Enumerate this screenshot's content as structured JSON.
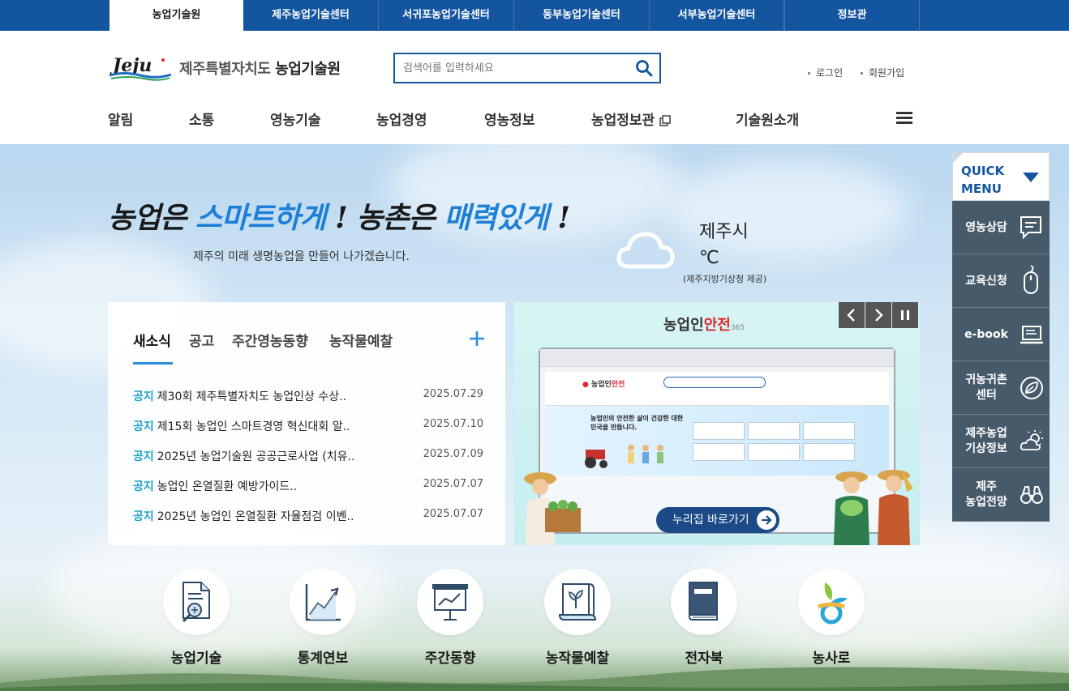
{
  "top_tabs": [
    "농업기술원",
    "제주농업기술센터",
    "서귀포농업기술센터",
    "동부농업기술센터",
    "서부농업기술센터",
    "정보관"
  ],
  "header": {
    "logo_text": "Jeju",
    "site_name_prefix": "제주특별자치도",
    "site_name": "농업기술원",
    "search_placeholder": "검색어를 입력하세요",
    "login": "로그인",
    "join": "회원가입"
  },
  "gnb": [
    "알림",
    "소통",
    "영농기술",
    "농업경영",
    "영농정보",
    "농업정보관",
    "기술원소개"
  ],
  "visual": {
    "slogan_a": "농업은 ",
    "slogan_b": "스마트하게",
    "slogan_c": " ! 농촌은 ",
    "slogan_d": "매력있게",
    "slogan_e": " !",
    "subtitle": "제주의 미래 생명농업을 만들어 나가겠습니다."
  },
  "weather": {
    "city": "제주시",
    "temp": "℃",
    "source": "(제주지방기상청 제공)",
    "icon": "cloud-icon"
  },
  "news": {
    "tabs": [
      "새소식",
      "공고",
      "주간영농동향",
      "농작물예찰"
    ],
    "items": [
      {
        "badge": "공지",
        "title": "제30회 제주특별자치도 농업인상 수상..",
        "date": "2025.07.29"
      },
      {
        "badge": "공지",
        "title": "제15회 농업인 스마트경영 혁신대회 알..",
        "date": "2025.07.10"
      },
      {
        "badge": "공지",
        "title": "2025년 농업기술원 공공근로사업 (치유..",
        "date": "2025.07.09"
      },
      {
        "badge": "공지",
        "title": "농업인 온열질환 예방가이드..",
        "date": "2025.07.07"
      },
      {
        "badge": "공지",
        "title": "2025년 농업인 온열질환 자율점검 이벤..",
        "date": "2025.07.07"
      }
    ]
  },
  "banner": {
    "logo_a": "농업인",
    "logo_b": "안전",
    "logo_c": "365",
    "hero_text": "농업인의 안전한 삶이 건강한 대한민국을 만듭니다.",
    "button": "누리집 바로가기"
  },
  "quick_menu": {
    "title_line1": "QUICK",
    "title_line2": "MENU",
    "items": [
      {
        "line1": "영농상담",
        "line2": "",
        "icon": "chat-icon"
      },
      {
        "line1": "교육신청",
        "line2": "",
        "icon": "mouse-icon"
      },
      {
        "line1": "e-book",
        "line2": "",
        "icon": "laptop-icon"
      },
      {
        "line1": "귀농귀촌",
        "line2": "센터",
        "icon": "leaf-icon"
      },
      {
        "line1": "제주농업",
        "line2": "기상정보",
        "icon": "weather-icon"
      },
      {
        "line1": "제주",
        "line2": "농업전망",
        "icon": "binoculars-icon"
      }
    ]
  },
  "services": [
    {
      "label": "농업기술",
      "icon": "document-search-icon"
    },
    {
      "label": "통계연보",
      "icon": "chart-icon"
    },
    {
      "label": "주간동향",
      "icon": "presentation-icon"
    },
    {
      "label": "농작물예찰",
      "icon": "sprout-scroll-icon"
    },
    {
      "label": "전자북",
      "icon": "book-icon"
    },
    {
      "label": "농사로",
      "icon": "nongsaro-icon"
    }
  ],
  "colors": {
    "primary": "#1455a0",
    "accent": "#2d8ee0",
    "badge": "#1ea0c8",
    "quick": "#475a6a"
  }
}
